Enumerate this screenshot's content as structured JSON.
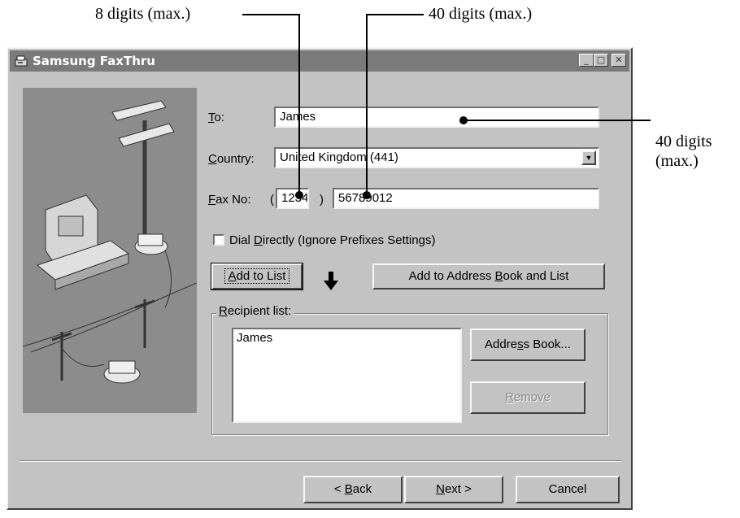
{
  "annotations": {
    "left": "8 digits (max.)",
    "middle": "40 digits (max.)",
    "right_line1": "40 digits",
    "right_line2": "(max.)"
  },
  "window": {
    "title": "Samsung FaxThru",
    "minimize": "_",
    "maximize": "□",
    "close": "✕"
  },
  "form": {
    "to_label_pre": "",
    "to_label_key": "T",
    "to_label_post": "o:",
    "to_value": "James",
    "country_label_key": "C",
    "country_label_post": "ountry:",
    "country_value": "United Kingdom (441)",
    "fax_label_key": "F",
    "fax_label_post": "ax No:",
    "fax_open_paren": "(",
    "fax_close_paren": ")",
    "fax_area_code": "1234",
    "fax_number": "56789012",
    "dial_directly_pre": "Dial ",
    "dial_directly_key": "D",
    "dial_directly_post": "irectly (Ignore Prefixes Settings)",
    "dial_directly_checked": false
  },
  "buttons": {
    "add_to_list_key": "A",
    "add_to_list_post": "dd to List",
    "add_to_address_book_pre": "Add to Address ",
    "add_to_address_book_key": "B",
    "add_to_address_book_post": "ook and List",
    "address_book_pre": "Addre",
    "address_book_key": "s",
    "address_book_post": "s Book...",
    "remove_key": "R",
    "remove_post": "emove",
    "back_pre": "< ",
    "back_key": "B",
    "back_post": "ack",
    "next_key": "N",
    "next_post": "ext >",
    "cancel": "Cancel"
  },
  "recipient_list": {
    "legend_key": "R",
    "legend_post": "ecipient list:",
    "items": [
      "James"
    ]
  },
  "icons": {
    "down_arrow": "down-arrow-icon",
    "app": "fax-app-icon",
    "dropdown": "dropdown-arrow-icon"
  },
  "colors": {
    "dialog_bg": "#c3c3c3",
    "titlebar": "#7a7a7a",
    "illustration_bg": "#8c8c8c"
  }
}
